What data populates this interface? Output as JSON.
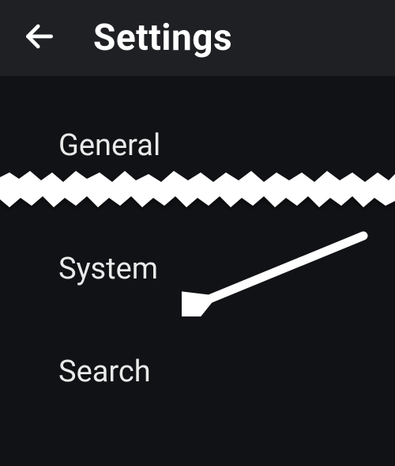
{
  "header": {
    "title": "Settings"
  },
  "items": [
    {
      "label": "General"
    },
    {
      "label": "System"
    },
    {
      "label": "Search"
    }
  ]
}
